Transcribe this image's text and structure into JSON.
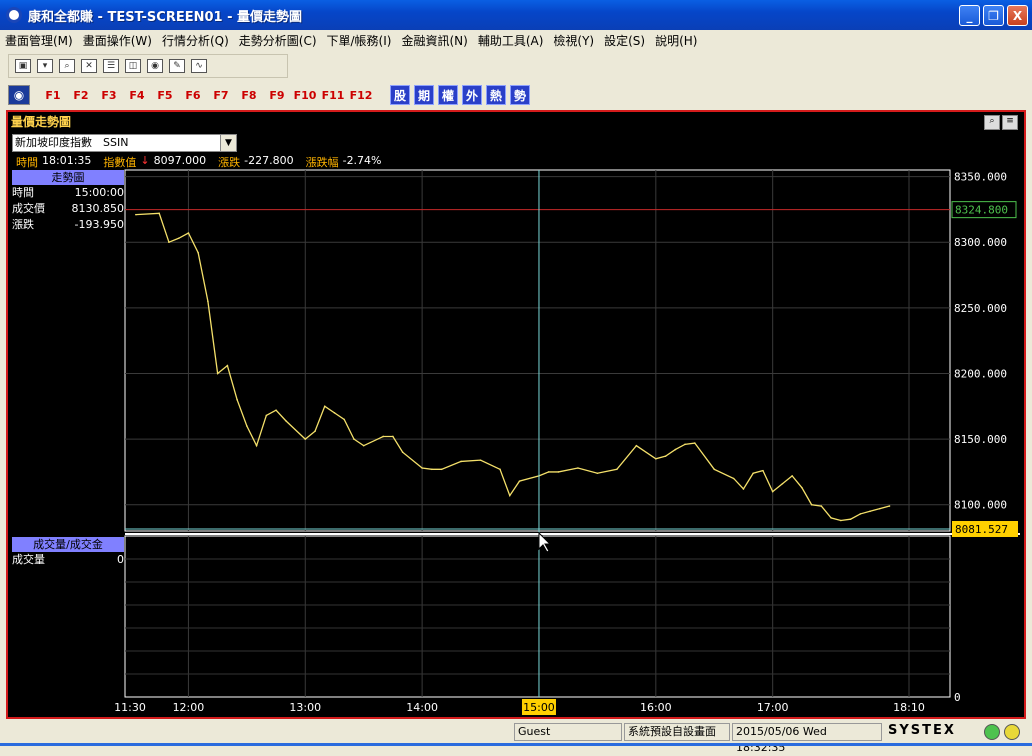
{
  "window": {
    "title": "康和全都賺 - TEST-SCREEN01 - 量價走勢圖",
    "buttons": [
      "_",
      "❐",
      "X"
    ]
  },
  "menu": [
    "畫面管理(M)",
    "畫面操作(W)",
    "行情分析(Q)",
    "走勢分析圖(C)",
    "下單/帳務(I)",
    "金融資訊(N)",
    "輔助工具(A)",
    "檢視(Y)",
    "設定(S)",
    "說明(H)"
  ],
  "toolbar2": {
    "fkeys": [
      "F1",
      "F2",
      "F3",
      "F4",
      "F5",
      "F6",
      "F7",
      "F8",
      "F9",
      "F10",
      "F11",
      "F12"
    ],
    "cbtns": [
      "股",
      "期",
      "權",
      "外",
      "熱",
      "勢"
    ]
  },
  "panel": {
    "title": "量價走勢圖",
    "select_value": "新加坡印度指數　SSIN",
    "info": {
      "time_label": "時間",
      "time": "18:01:35",
      "index_label": "指數值",
      "index": "8097.000",
      "change_label": "漲跌",
      "change": "-227.800",
      "pct_label": "漲跌幅",
      "pct": "-2.74%"
    },
    "trend": {
      "head": "走勢圖",
      "rows": [
        {
          "label": "時間",
          "value": "15:00:00"
        },
        {
          "label": "成交價",
          "value": "8130.850"
        },
        {
          "label": "漲跌",
          "value": "-193.950"
        }
      ]
    },
    "volume": {
      "head": "成交量/成交金",
      "rows": [
        {
          "label": "成交量",
          "value": "0"
        }
      ]
    },
    "ref_price": "8324.800",
    "cursor_price": "8081.527",
    "cursor_time": "15:00",
    "vol_axis_zero": "0"
  },
  "chart_data": {
    "type": "line",
    "y_ticks": [
      "8350.000",
      "8300.000",
      "8250.000",
      "8200.000",
      "8150.000",
      "8100.000"
    ],
    "x_ticks": [
      "11:30",
      "12:00",
      "13:00",
      "14:00",
      "15:00",
      "16:00",
      "17:00",
      "18:10"
    ],
    "ylim": [
      8080,
      8355
    ],
    "x": [
      "11:33",
      "11:45",
      "11:50",
      "11:55",
      "12:00",
      "12:05",
      "12:10",
      "12:15",
      "12:20",
      "12:25",
      "12:30",
      "12:35",
      "12:40",
      "12:45",
      "12:50",
      "13:00",
      "13:05",
      "13:10",
      "13:15",
      "13:20",
      "13:25",
      "13:30",
      "13:40",
      "13:45",
      "13:50",
      "14:00",
      "14:05",
      "14:10",
      "14:20",
      "14:30",
      "14:40",
      "14:45",
      "14:50",
      "15:00",
      "15:05",
      "15:10",
      "15:20",
      "15:30",
      "15:40",
      "15:50",
      "16:00",
      "16:05",
      "16:10",
      "16:15",
      "16:20",
      "16:30",
      "16:40",
      "16:45",
      "16:50",
      "16:55",
      "17:00",
      "17:05",
      "17:10",
      "17:15",
      "17:20",
      "17:25",
      "17:30",
      "17:35",
      "17:40",
      "17:45",
      "17:50",
      "17:55",
      "18:00"
    ],
    "y": [
      8321,
      8322,
      8300,
      8303,
      8307,
      8292,
      8255,
      8200,
      8206,
      8180,
      8160,
      8145,
      8168,
      8172,
      8164,
      8150,
      8156,
      8175,
      8170,
      8165,
      8150,
      8145,
      8152,
      8152,
      8140,
      8128,
      8127,
      8127,
      8133,
      8134,
      8127,
      8107,
      8118,
      8122,
      8125,
      8125,
      8128,
      8124,
      8127,
      8145,
      8135,
      8137,
      8142,
      8146,
      8147,
      8127,
      8120,
      8112,
      8124,
      8126,
      8110,
      8116,
      8122,
      8113,
      8100,
      8099,
      8090,
      8088,
      8089,
      8093,
      8095,
      8097,
      8099
    ]
  },
  "status": {
    "user": "Guest",
    "screen": "系統預設自設畫面",
    "datetime": "2015/05/06 Wed 18:32:35",
    "brand": "SYSTEX"
  }
}
